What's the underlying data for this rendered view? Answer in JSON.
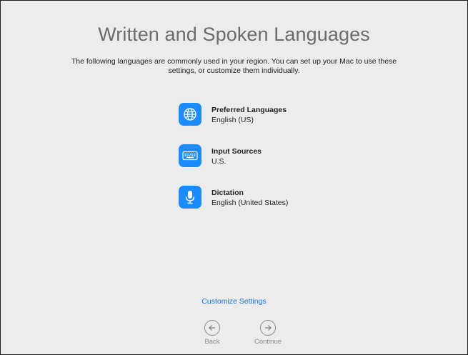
{
  "page": {
    "title": "Written and Spoken Languages",
    "subtitle_line1": "The following languages are commonly used in your region. You can set up your Mac to use these",
    "subtitle_line2": "settings, or customize them individually."
  },
  "items": [
    {
      "title": "Preferred Languages",
      "value": "English (US)",
      "icon": "globe-icon"
    },
    {
      "title": "Input Sources",
      "value": "U.S.",
      "icon": "keyboard-icon"
    },
    {
      "title": "Dictation",
      "value": "English (United States)",
      "icon": "microphone-icon"
    }
  ],
  "customize_label": "Customize Settings",
  "nav": {
    "back_label": "Back",
    "continue_label": "Continue"
  },
  "colors": {
    "accent": "#1a8cff",
    "link": "#1a6fd6",
    "background": "#ececec"
  }
}
